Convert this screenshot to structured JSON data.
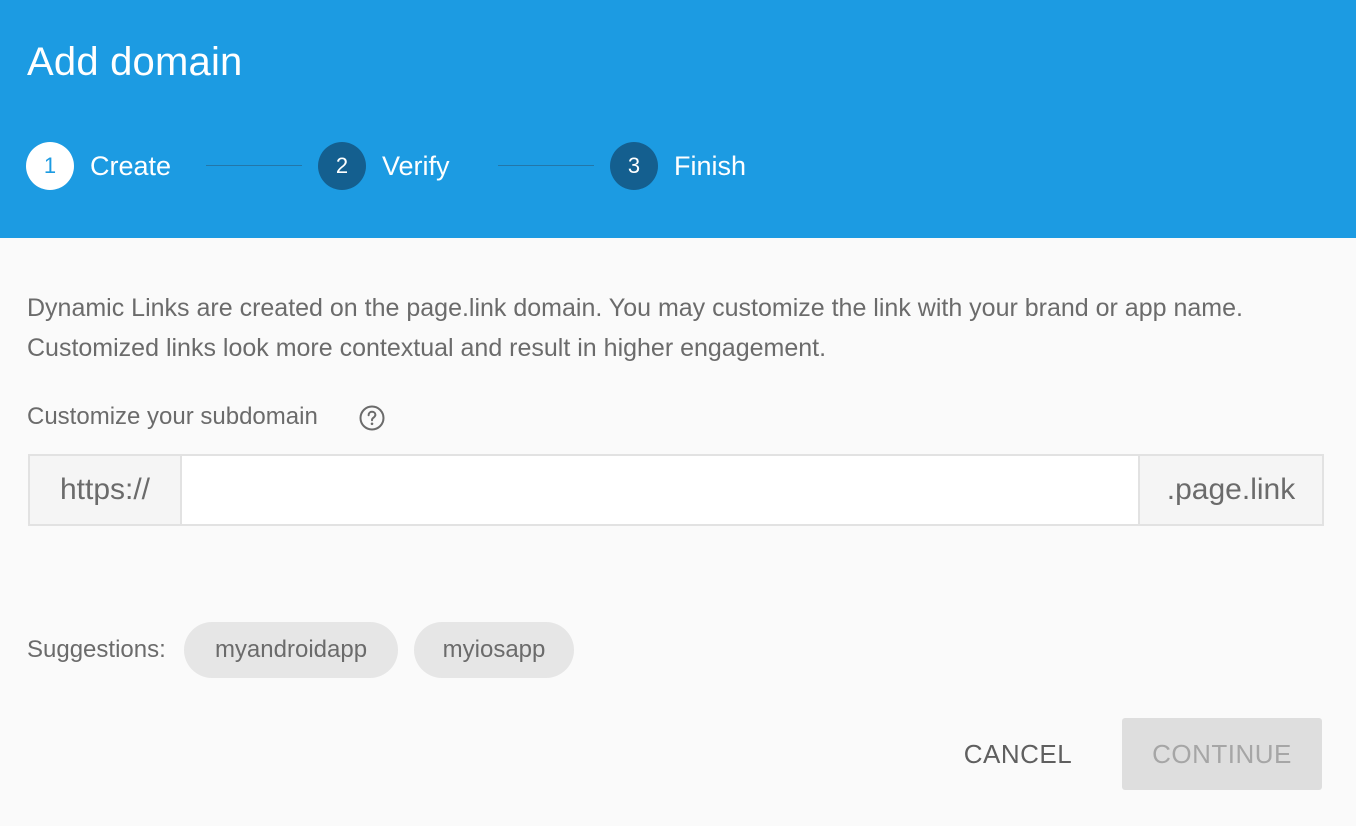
{
  "dialog": {
    "title": "Add domain"
  },
  "stepper": {
    "steps": [
      {
        "number": "1",
        "label": "Create",
        "state": "active"
      },
      {
        "number": "2",
        "label": "Verify",
        "state": "inactive"
      },
      {
        "number": "3",
        "label": "Finish",
        "state": "inactive"
      }
    ]
  },
  "content": {
    "description": "Dynamic Links are created on the page.link domain. You may customize the link with your brand or app name. Customized links look more contextual and result in higher engagement.",
    "field_label": "Customize your subdomain",
    "help_icon": "help-circle-icon",
    "prefix": "https://",
    "subdomain_value": "",
    "suffix": ".page.link",
    "suggestions_label": "Suggestions:",
    "suggestions": [
      "myandroidapp",
      "myiosapp"
    ]
  },
  "actions": {
    "cancel_label": "CANCEL",
    "continue_label": "CONTINUE",
    "continue_disabled": true
  },
  "colors": {
    "header_background": "#1c9be2",
    "active_step_circle": "#ffffff",
    "inactive_step_circle": "#145f8f",
    "body_background": "#fafafa",
    "chip_background": "#e6e6e6",
    "disabled_button_background": "#dedede"
  }
}
